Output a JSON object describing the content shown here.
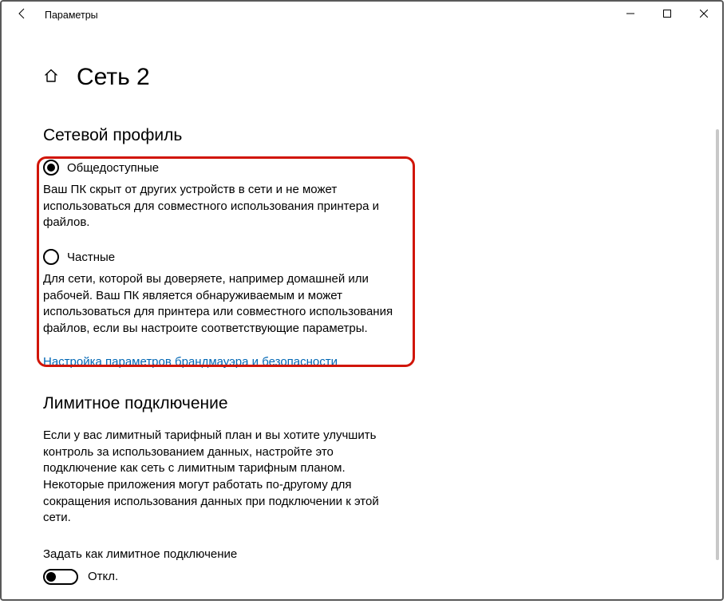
{
  "window": {
    "title": "Параметры"
  },
  "header": {
    "page_title": "Сеть 2"
  },
  "profile": {
    "section_title": "Сетевой профиль",
    "options": [
      {
        "label": "Общедоступные",
        "desc": "Ваш ПК скрыт от других устройств в сети и не может использоваться для совместного использования принтера и файлов.",
        "checked": true
      },
      {
        "label": "Частные",
        "desc": "Для сети, которой вы доверяете, например домашней или рабочей. Ваш ПК является обнаруживаемым и может использоваться для принтера или совместного использования файлов, если вы настроите соответствующие параметры.",
        "checked": false
      }
    ],
    "firewall_link": "Настройка параметров брандмауэра и безопасности"
  },
  "metered": {
    "section_title": "Лимитное подключение",
    "desc": "Если у вас лимитный тарифный план и вы хотите улучшить контроль за использованием данных, настройте это подключение как сеть с лимитным тарифным планом. Некоторые приложения могут работать по-другому для сокращения использования данных при подключении к этой сети.",
    "toggle_caption": "Задать как лимитное подключение",
    "toggle_state_label": "Откл."
  }
}
